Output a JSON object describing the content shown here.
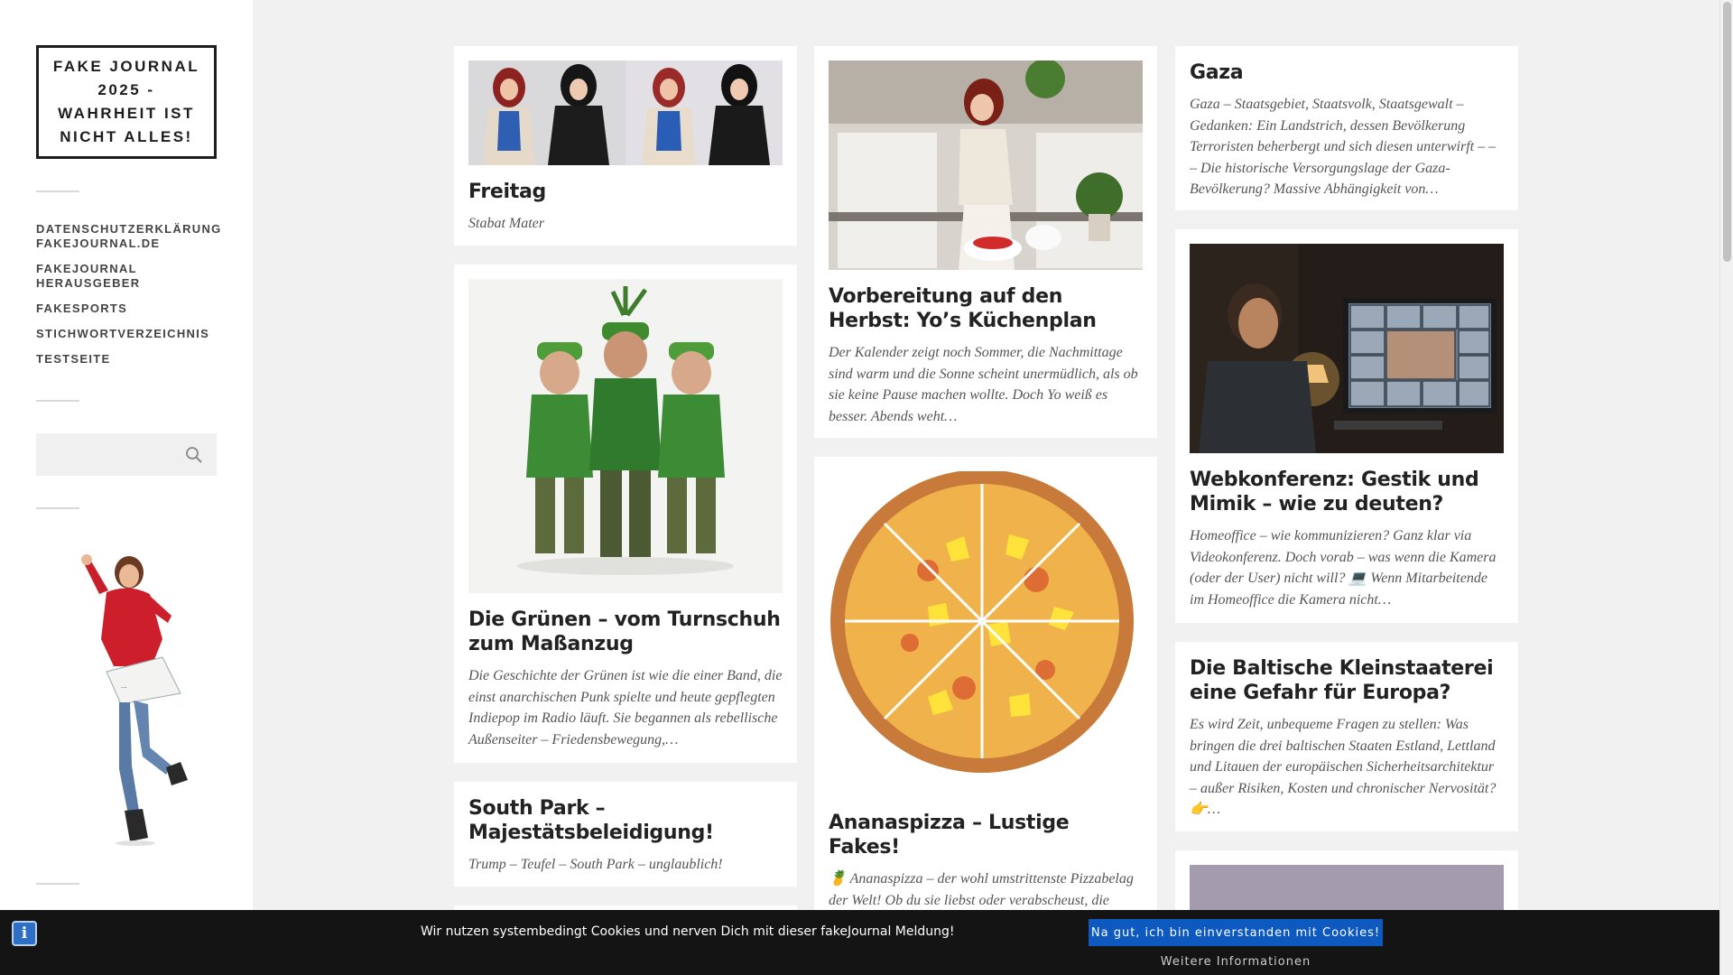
{
  "site": {
    "title": "FAKE JOURNAL 2025 - WAHRHEIT IST NICHT ALLES!"
  },
  "menu": {
    "items": [
      "DATENSCHUTZERKLÄRUNG FAKEJOURNAL.DE",
      "FAKEJOURNAL HERAUSGEBER",
      "FAKESPORTS",
      "STICHWORTVERZEICHNIS",
      "TESTSEITE"
    ]
  },
  "search": {
    "value": "",
    "placeholder": ""
  },
  "posts": {
    "freitag": {
      "title": "Freitag",
      "excerpt": "Stabat Mater"
    },
    "gruenen": {
      "title": "Die Grünen – vom Turnschuh zum Maßanzug",
      "excerpt": "Die Geschichte der Grünen ist wie die einer Band, die einst anarchischen Punk spielte und heute gepflegten Indiepop im Radio läuft. Sie begannen als rebellische Außenseiter – Friedensbewegung,…"
    },
    "southpark": {
      "title": "South Park – Majestätsbeleidigung!",
      "excerpt": "Trump – Teufel – South Park – unglaublich!"
    },
    "herbst": {
      "title": "Vorbereitung auf den Herbst: Yo’s Küchenplan",
      "excerpt": "Der Kalender zeigt noch Sommer, die Nachmittage sind warm und die Sonne scheint unermüdlich, als ob sie keine Pause machen wollte. Doch Yo weiß es besser. Abends weht…"
    },
    "pizza": {
      "title": "Ananaspizza – Lustige Fakes!",
      "excerpt": "🍍 Ananaspizza – der wohl umstrittenste Pizzabelag der Welt! Ob du sie liebst oder verabscheust, die Kombination aus süßer Frucht und herzhaftem Käse sorgt weltweit für hitzige Diskussionen…"
    },
    "gaza": {
      "title": "Gaza",
      "excerpt": "Gaza – Staatsgebiet, Staatsvolk, Staatsgewalt – Gedanken: Ein Landstrich, dessen Bevölkerung Terroristen beherbergt und sich diesen unterwirft – – – Die historische Versorgungslage der Gaza-Bevölkerung? Massive Abhängigkeit von…"
    },
    "webkonferenz": {
      "title": "Webkonferenz: Gestik und Mimik – wie zu deuten?",
      "excerpt": "Homeoffice – wie kommunizieren? Ganz klar via Videokonferenz. Doch vorab – was wenn die Kamera (oder der User) nicht will? 💻 Wenn Mitarbeitende im Homeoffice die Kamera nicht…"
    },
    "baltisch": {
      "title": "Die Baltische Kleinstaaterei eine Gefahr für Europa?",
      "excerpt": "Es wird Zeit, unbequeme Fragen zu stellen: Was bringen die drei baltischen Staaten Estland, Lettland und Litauen der europäischen Sicherheitsarchitektur – außer Risiken, Kosten und chronischer Nervosität? 👉…"
    }
  },
  "cookie": {
    "message": "Wir nutzen systembedingt Cookies und nerven Dich mit dieser fakeJournal Meldung!",
    "accept_label": "Na gut, ich bin einverstanden mit Cookies!",
    "more_label": "Weitere Informationen"
  },
  "icons": {
    "search": "search-icon",
    "info": "info-icon"
  },
  "colors": {
    "accent": "#0d59bf",
    "sidebar": "#ffffff",
    "background": "#f1f1f1"
  }
}
